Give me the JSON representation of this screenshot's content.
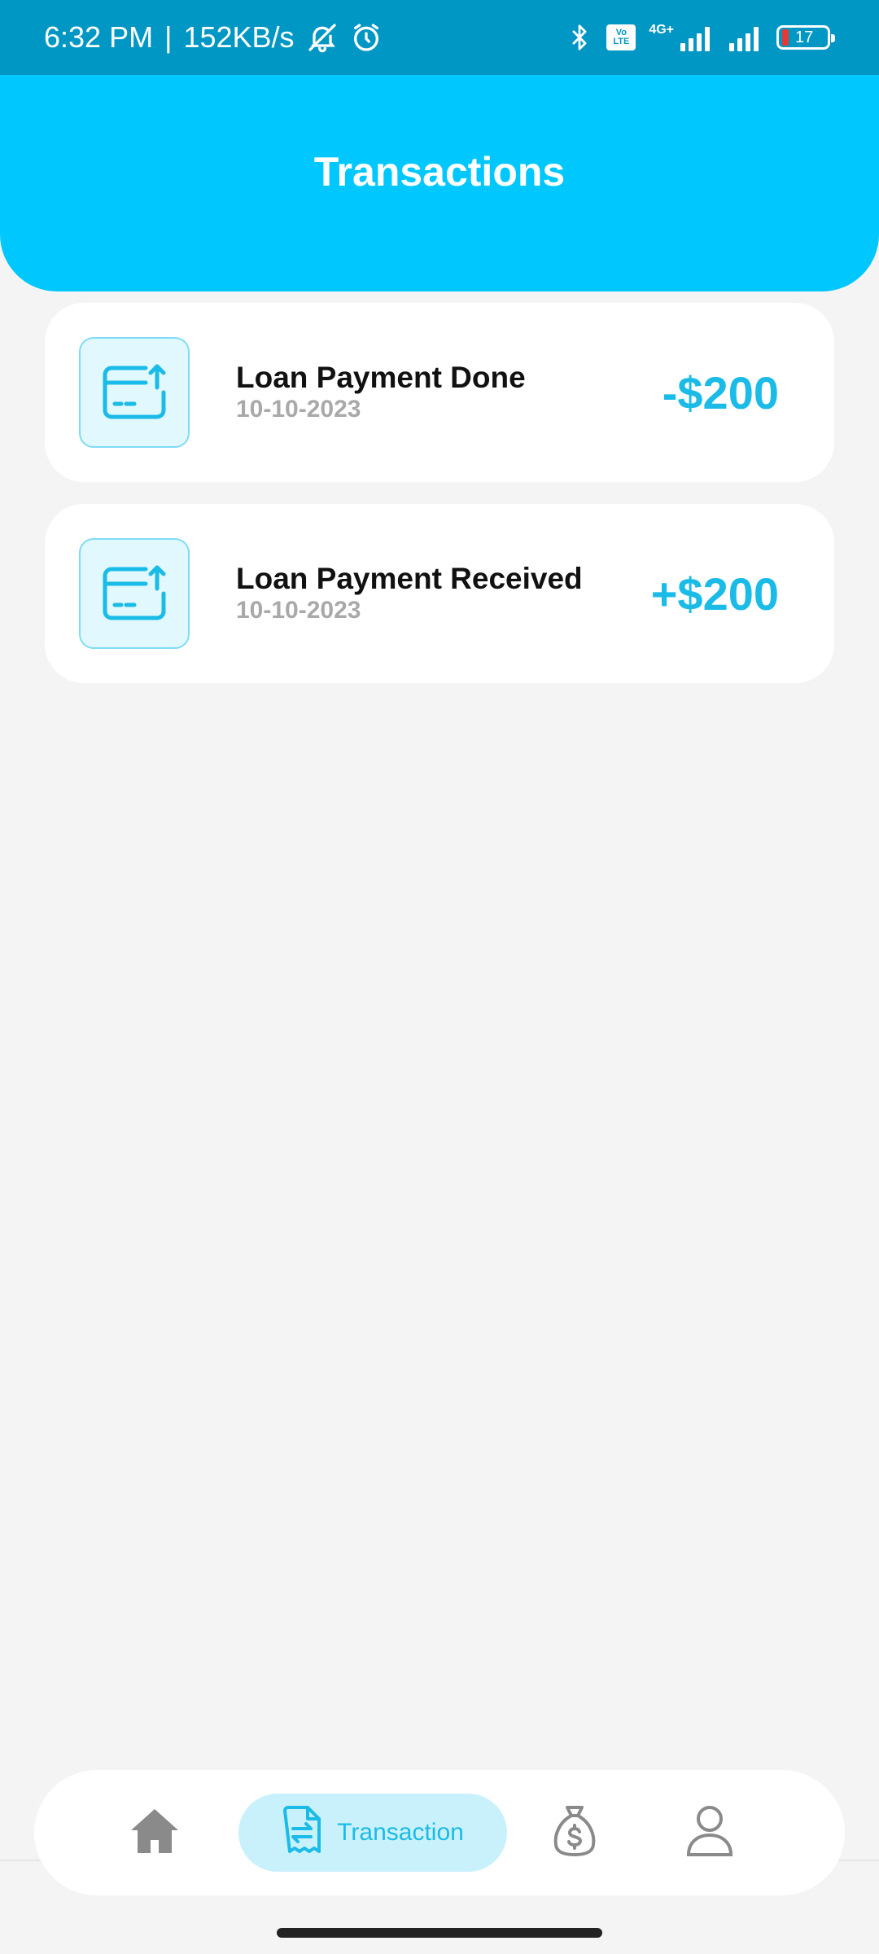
{
  "status_bar": {
    "time": "6:32 PM",
    "separator": "|",
    "network_speed": "152KB/s",
    "network_type": "4G+",
    "volte": "Vo LTE",
    "battery_level": "17"
  },
  "header": {
    "title": "Transactions"
  },
  "transactions": [
    {
      "title": "Loan Payment Done",
      "date": "10-10-2023",
      "amount": "-$200",
      "icon": "card-upload-icon"
    },
    {
      "title": "Loan Payment Received",
      "date": "10-10-2023",
      "amount": "+$200",
      "icon": "card-upload-icon"
    }
  ],
  "bottom_nav": {
    "active_label": "Transaction",
    "items": [
      "home-icon",
      "transaction-icon",
      "money-bag-icon",
      "profile-icon"
    ]
  },
  "colors": {
    "status_bar": "#0097c4",
    "header": "#00c8ff",
    "accent": "#1bbbe8",
    "background": "#f4f4f4"
  }
}
